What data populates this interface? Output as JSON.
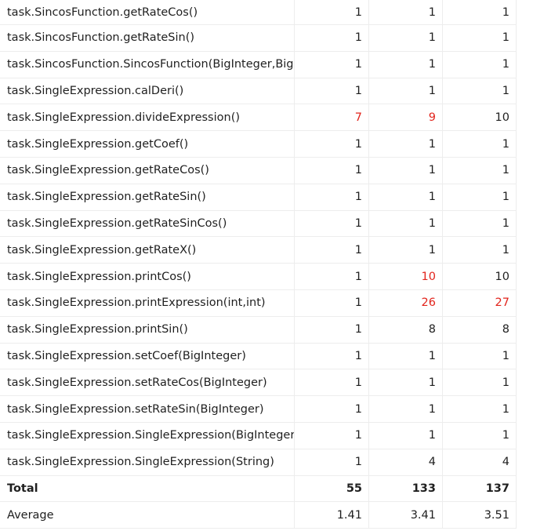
{
  "rows": [
    {
      "name": "task.SincosFunction.getRateCos()",
      "v1": "1",
      "v2": "1",
      "v3": "1",
      "r1": false,
      "r2": false,
      "r3": false
    },
    {
      "name": "task.SincosFunction.getRateSin()",
      "v1": "1",
      "v2": "1",
      "v3": "1",
      "r1": false,
      "r2": false,
      "r3": false
    },
    {
      "name": "task.SincosFunction.SincosFunction(BigInteger,Big",
      "v1": "1",
      "v2": "1",
      "v3": "1",
      "r1": false,
      "r2": false,
      "r3": false
    },
    {
      "name": "task.SingleExpression.calDeri()",
      "v1": "1",
      "v2": "1",
      "v3": "1",
      "r1": false,
      "r2": false,
      "r3": false
    },
    {
      "name": "task.SingleExpression.divideExpression()",
      "v1": "7",
      "v2": "9",
      "v3": "10",
      "r1": true,
      "r2": true,
      "r3": false
    },
    {
      "name": "task.SingleExpression.getCoef()",
      "v1": "1",
      "v2": "1",
      "v3": "1",
      "r1": false,
      "r2": false,
      "r3": false
    },
    {
      "name": "task.SingleExpression.getRateCos()",
      "v1": "1",
      "v2": "1",
      "v3": "1",
      "r1": false,
      "r2": false,
      "r3": false
    },
    {
      "name": "task.SingleExpression.getRateSin()",
      "v1": "1",
      "v2": "1",
      "v3": "1",
      "r1": false,
      "r2": false,
      "r3": false
    },
    {
      "name": "task.SingleExpression.getRateSinCos()",
      "v1": "1",
      "v2": "1",
      "v3": "1",
      "r1": false,
      "r2": false,
      "r3": false
    },
    {
      "name": "task.SingleExpression.getRateX()",
      "v1": "1",
      "v2": "1",
      "v3": "1",
      "r1": false,
      "r2": false,
      "r3": false
    },
    {
      "name": "task.SingleExpression.printCos()",
      "v1": "1",
      "v2": "10",
      "v3": "10",
      "r1": false,
      "r2": true,
      "r3": false
    },
    {
      "name": "task.SingleExpression.printExpression(int,int)",
      "v1": "1",
      "v2": "26",
      "v3": "27",
      "r1": false,
      "r2": true,
      "r3": true
    },
    {
      "name": "task.SingleExpression.printSin()",
      "v1": "1",
      "v2": "8",
      "v3": "8",
      "r1": false,
      "r2": false,
      "r3": false
    },
    {
      "name": "task.SingleExpression.setCoef(BigInteger)",
      "v1": "1",
      "v2": "1",
      "v3": "1",
      "r1": false,
      "r2": false,
      "r3": false
    },
    {
      "name": "task.SingleExpression.setRateCos(BigInteger)",
      "v1": "1",
      "v2": "1",
      "v3": "1",
      "r1": false,
      "r2": false,
      "r3": false
    },
    {
      "name": "task.SingleExpression.setRateSin(BigInteger)",
      "v1": "1",
      "v2": "1",
      "v3": "1",
      "r1": false,
      "r2": false,
      "r3": false
    },
    {
      "name": "task.SingleExpression.SingleExpression(BigInteger,",
      "v1": "1",
      "v2": "1",
      "v3": "1",
      "r1": false,
      "r2": false,
      "r3": false
    },
    {
      "name": "task.SingleExpression.SingleExpression(String)",
      "v1": "1",
      "v2": "4",
      "v3": "4",
      "r1": false,
      "r2": false,
      "r3": false
    }
  ],
  "total": {
    "label": "Total",
    "v1": "55",
    "v2": "133",
    "v3": "137"
  },
  "average": {
    "label": "Average",
    "v1": "1.41",
    "v2": "3.41",
    "v3": "3.51"
  },
  "colors": {
    "highlight": "#e2241c",
    "text": "#1f1f1f",
    "grid": "#ededed"
  }
}
